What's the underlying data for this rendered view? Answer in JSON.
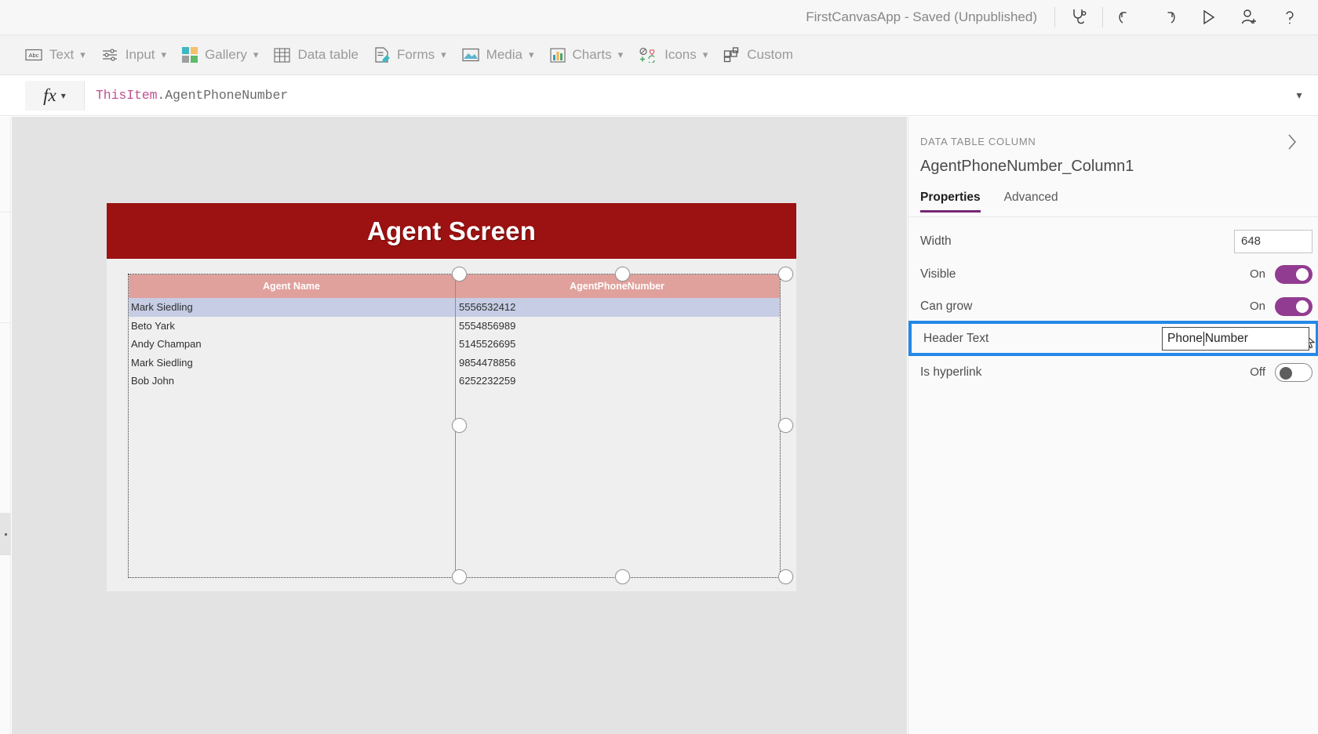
{
  "topbar": {
    "app_title": "FirstCanvasApp - Saved (Unpublished)",
    "buttons": [
      {
        "name": "app-checker-icon",
        "label": "App checker"
      },
      {
        "name": "undo-icon",
        "label": "Undo"
      },
      {
        "name": "redo-icon",
        "label": "Redo"
      },
      {
        "name": "preview-icon",
        "label": "Preview the app"
      },
      {
        "name": "share-icon",
        "label": "Share"
      },
      {
        "name": "help-icon",
        "label": "Help"
      }
    ]
  },
  "ribbon": {
    "items": [
      {
        "label": "Text",
        "icon": "text-abc-icon",
        "chevron": true
      },
      {
        "label": "Input",
        "icon": "input-sliders-icon",
        "chevron": true
      },
      {
        "label": "Gallery",
        "icon": "gallery-squares-icon",
        "chevron": true
      },
      {
        "label": "Data table",
        "icon": "data-table-icon",
        "chevron": false
      },
      {
        "label": "Forms",
        "icon": "forms-icon",
        "chevron": true
      },
      {
        "label": "Media",
        "icon": "media-image-icon",
        "chevron": true
      },
      {
        "label": "Charts",
        "icon": "charts-bar-icon",
        "chevron": true
      },
      {
        "label": "Icons",
        "icon": "icons-shapes-icon",
        "chevron": true
      },
      {
        "label": "Custom",
        "icon": "custom-blocks-icon",
        "chevron": false
      }
    ]
  },
  "formula_bar": {
    "fx_label": "fx",
    "expression_this": "ThisItem",
    "expression_prop": ".AgentPhoneNumber"
  },
  "canvas": {
    "screen_title": "Agent Screen",
    "header_color": "#9c1111",
    "table": {
      "columns": [
        "Agent Name",
        "AgentPhoneNumber"
      ],
      "rows": [
        {
          "name": "Mark Siedling",
          "phone": "5556532412",
          "selected": true
        },
        {
          "name": "Beto Yark",
          "phone": "5554856989",
          "selected": false
        },
        {
          "name": "Andy Champan",
          "phone": "5145526695",
          "selected": false
        },
        {
          "name": "Mark Siedling",
          "phone": "9854478856",
          "selected": false
        },
        {
          "name": "Bob John",
          "phone": "6252232259",
          "selected": false
        }
      ]
    }
  },
  "properties_panel": {
    "kicker": "DATA TABLE COLUMN",
    "control_name": "AgentPhoneNumber_Column1",
    "tabs": [
      {
        "label": "Properties",
        "active": true
      },
      {
        "label": "Advanced",
        "active": false
      }
    ],
    "rows": {
      "width": {
        "label": "Width",
        "value": "648"
      },
      "visible": {
        "label": "Visible",
        "state": "On"
      },
      "can_grow": {
        "label": "Can grow",
        "state": "On"
      },
      "header_text": {
        "label": "Header Text",
        "value_before_caret": "Phone ",
        "value_after_caret": "Number"
      },
      "is_hyperlink": {
        "label": "Is hyperlink",
        "state": "Off"
      }
    },
    "accent_color": "#742774",
    "focus_color": "#2488e8"
  }
}
